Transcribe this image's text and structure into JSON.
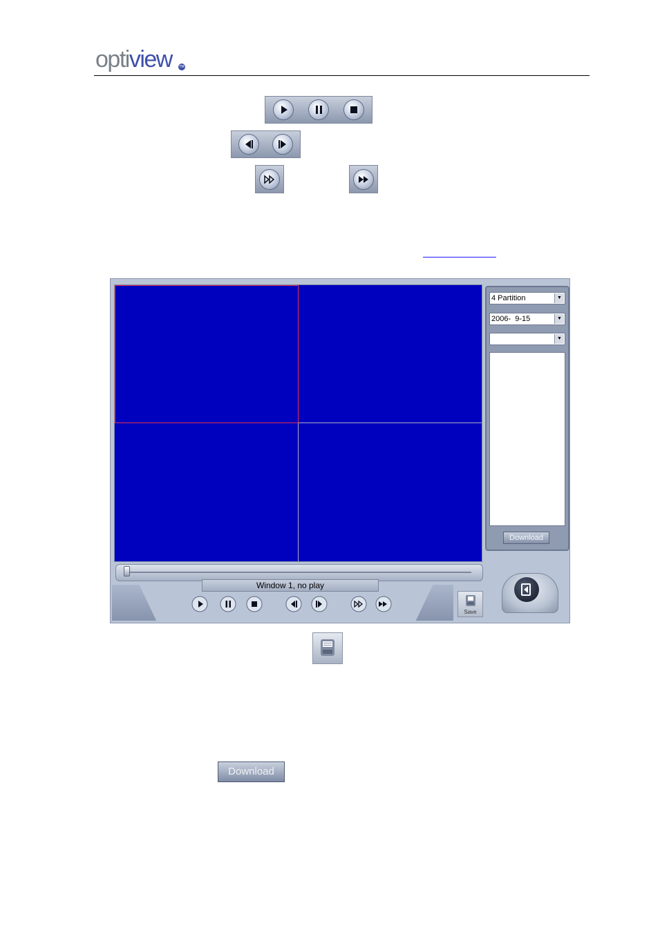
{
  "header": {
    "logo_part1": "opti",
    "logo_part2": "view",
    "logo_mark": "TM"
  },
  "inline_buttons": {
    "group1": [
      "play-icon",
      "pause-icon",
      "stop-icon"
    ],
    "group2": [
      "frame-back-icon",
      "frame-forward-icon"
    ],
    "slow_forward": "slow-forward-icon",
    "fast_forward": "fast-forward-icon"
  },
  "app": {
    "partition_select": "4 Partition",
    "date_select": "2006-  9-15",
    "camera_select": "",
    "download_label": "Download",
    "status_text": "Window 1, no play",
    "save_label": "Save",
    "controls": [
      "play-icon",
      "pause-icon",
      "stop-icon",
      "frame-back-icon",
      "frame-forward-icon",
      "slow-forward-icon",
      "fast-forward-icon"
    ],
    "colors": {
      "video_bg": "#0000bf",
      "selected_frame": "#e0304a",
      "window_bg": "#b9c4d6"
    }
  },
  "below": {
    "download_button": "Download"
  }
}
